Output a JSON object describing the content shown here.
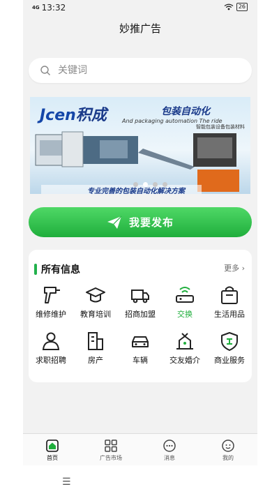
{
  "status": {
    "network": "4G",
    "time": "13:32",
    "battery": "26"
  },
  "header": {
    "title": "妙推广告"
  },
  "search": {
    "placeholder": "关键词"
  },
  "banner": {
    "brand": "Jcen",
    "brand_cn": "积成",
    "slogan": "包装自动化",
    "slogan_en": "And packaging automation The ride",
    "slogan_sub": "智能包装设备包装材料",
    "footer": "专业完善的包装自动化解决方案",
    "dots": 4,
    "active_dot": 1
  },
  "publish": {
    "label": "我要发布"
  },
  "section": {
    "title": "所有信息",
    "more": "更多",
    "items": [
      {
        "label": "维修维护",
        "icon": "drill-icon"
      },
      {
        "label": "教育培训",
        "icon": "graduation-cap-icon"
      },
      {
        "label": "招商加盟",
        "icon": "truck-icon"
      },
      {
        "label": "交换",
        "icon": "router-icon"
      },
      {
        "label": "生活用品",
        "icon": "shopping-bag-icon"
      },
      {
        "label": "求职招聘",
        "icon": "person-icon"
      },
      {
        "label": "房产",
        "icon": "building-icon"
      },
      {
        "label": "车辆",
        "icon": "car-icon"
      },
      {
        "label": "交友婚介",
        "icon": "gift-icon"
      },
      {
        "label": "商业服务",
        "icon": "shield-icon"
      }
    ]
  },
  "tabs": [
    {
      "label": "首页",
      "icon": "home-icon"
    },
    {
      "label": "广告市场",
      "icon": "grid-icon"
    },
    {
      "label": "消息",
      "icon": "message-icon"
    },
    {
      "label": "我的",
      "icon": "user-icon"
    }
  ],
  "colors": {
    "accent": "#22b14c",
    "accent_dark": "#1fae3c",
    "background": "#f2f2f2"
  }
}
